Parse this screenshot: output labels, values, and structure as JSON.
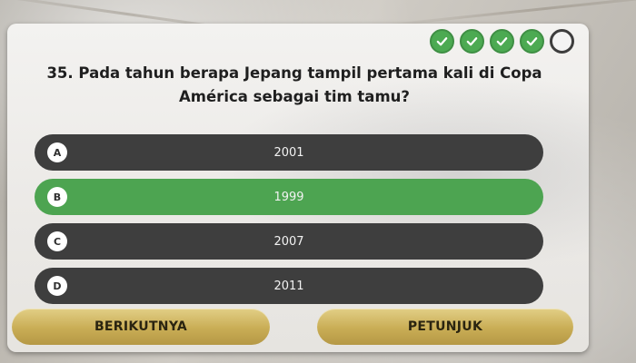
{
  "progress": {
    "answered_correct": 4,
    "total": 5,
    "indicators": [
      {
        "state": "correct",
        "icon": "check-icon"
      },
      {
        "state": "correct",
        "icon": "check-icon"
      },
      {
        "state": "correct",
        "icon": "check-icon"
      },
      {
        "state": "correct",
        "icon": "check-icon"
      },
      {
        "state": "pending",
        "icon": "empty-circle-icon"
      }
    ]
  },
  "question": {
    "line1": "35. Pada tahun berapa Jepang tampil pertama kali di Copa",
    "line2": "América sebagai tim tamu?"
  },
  "answers": [
    {
      "letter": "A",
      "text": "2001",
      "state": "default"
    },
    {
      "letter": "B",
      "text": "1999",
      "state": "correct"
    },
    {
      "letter": "C",
      "text": "2007",
      "state": "default"
    },
    {
      "letter": "D",
      "text": "2011",
      "state": "default"
    }
  ],
  "buttons": {
    "next_label": "BERIKUTNYA",
    "hint_label": "PETUNJUK"
  },
  "colors": {
    "correct": "#4da451",
    "answer_default": "#3e3e3e",
    "button_gold": "#c9ad55",
    "card": "#efedea"
  }
}
